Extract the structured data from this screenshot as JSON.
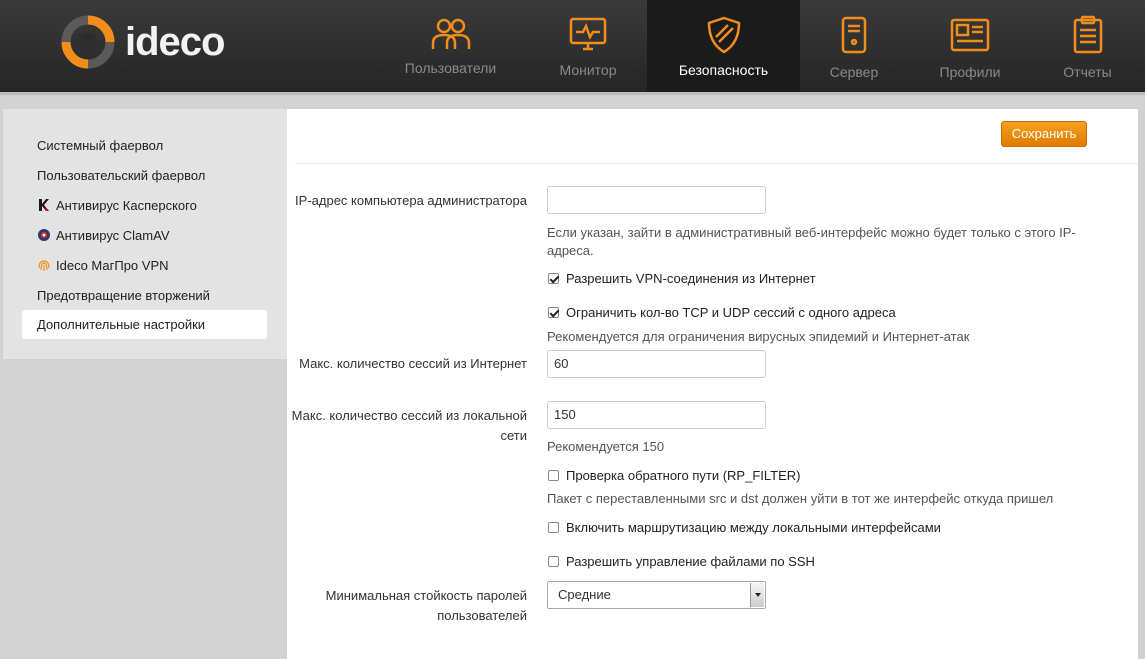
{
  "brand": {
    "name": "ideco",
    "accent": "#f28c1a"
  },
  "nav": [
    {
      "label": "Пользователи",
      "icon": "users-icon"
    },
    {
      "label": "Монитор",
      "icon": "monitor-icon"
    },
    {
      "label": "Безопасность",
      "icon": "shield-icon",
      "active": true
    },
    {
      "label": "Сервер",
      "icon": "server-icon"
    },
    {
      "label": "Профили",
      "icon": "profile-card-icon"
    },
    {
      "label": "Отчеты",
      "icon": "clipboard-icon"
    }
  ],
  "sidebar": {
    "items": [
      {
        "label": "Системный фаервол"
      },
      {
        "label": "Пользовательский фаервол"
      },
      {
        "label": "Антивирус Касперского",
        "icon": "kaspersky-icon"
      },
      {
        "label": "Антивирус ClamAV",
        "icon": "clamav-icon"
      },
      {
        "label": "Ideco МагПро VPN",
        "icon": "fingerprint-icon"
      },
      {
        "label": "Предотвращение вторжений"
      },
      {
        "label": "Дополнительные настройки",
        "active": true
      }
    ]
  },
  "toolbar": {
    "save_label": "Сохранить"
  },
  "form": {
    "admin_ip": {
      "label": "IP-адрес компьютера администратора",
      "value": "",
      "help": "Если указан, зайти в административный веб-интерфейс можно будет только с этого IP-адреса."
    },
    "allow_vpn": {
      "label": "Разрешить VPN-соединения из Интернет",
      "checked": true
    },
    "limit_sessions": {
      "label": "Ограничить кол-во TCP и UDP сессий с одного адреса",
      "checked": true,
      "help": "Рекомендуется для ограничения вирусных эпидемий и Интернет-атак"
    },
    "max_internet": {
      "label": "Макс. количество сессий из Интернет",
      "value": "60"
    },
    "max_local": {
      "label": "Макс. количество сессий из локальной сети",
      "value": "150",
      "help": "Рекомендуется 150"
    },
    "rp_filter": {
      "label": "Проверка обратного пути (RP_FILTER)",
      "checked": false,
      "help": "Пакет с переставленными src и dst должен уйти в тот же интерфейс откуда пришел"
    },
    "local_routing": {
      "label": "Включить маршрутизацию между локальными интерфейсами",
      "checked": false
    },
    "ssh_files": {
      "label": "Разрешить управление файлами по SSH",
      "checked": false
    },
    "password_strength": {
      "label": "Минимальная стойкость паролей пользователей",
      "value": "Средние"
    }
  }
}
